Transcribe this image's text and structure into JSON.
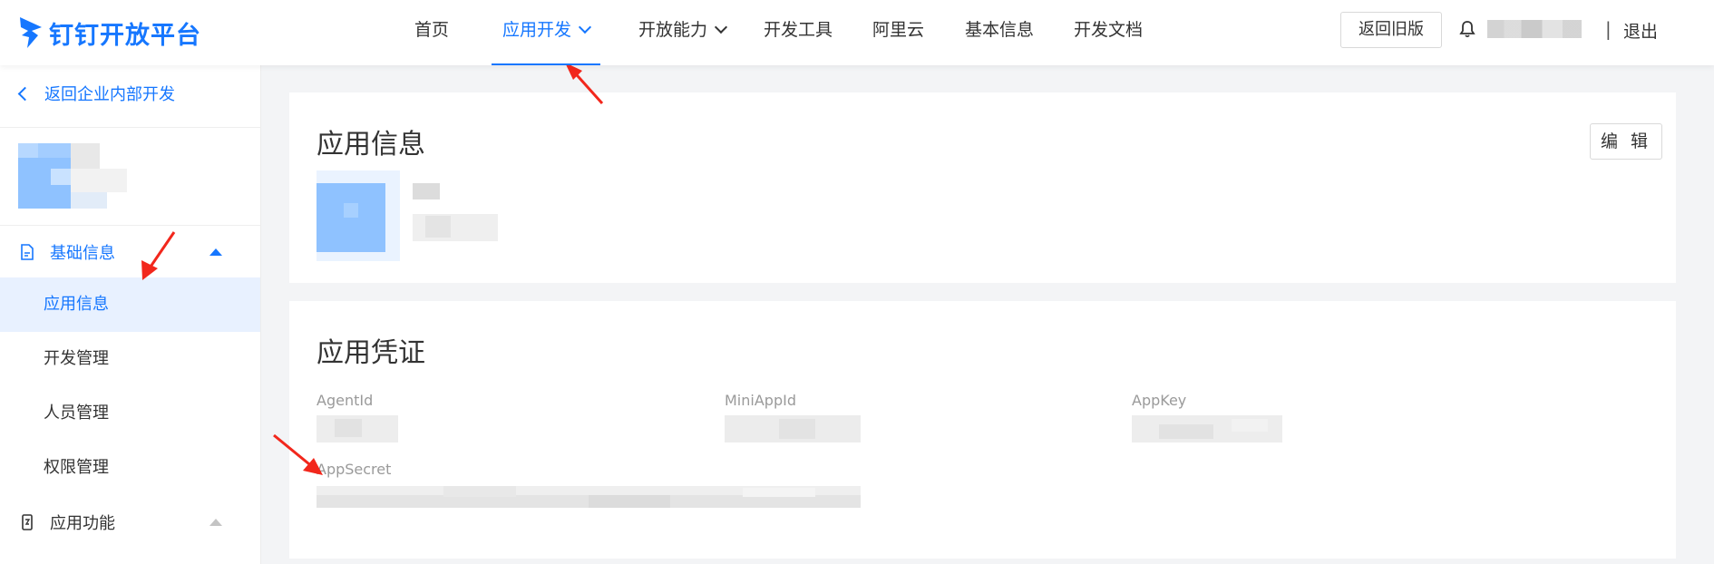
{
  "brand": {
    "name": "钉钉开放平台",
    "color": "#1677ff"
  },
  "nav": {
    "items": [
      {
        "label": "首页"
      },
      {
        "label": "应用开发"
      },
      {
        "label": "开放能力"
      },
      {
        "label": "开发工具"
      },
      {
        "label": "阿里云"
      },
      {
        "label": "基本信息"
      },
      {
        "label": "开发文档"
      }
    ],
    "old_version": "返回旧版",
    "separator": "|",
    "logout": "退出"
  },
  "sidebar": {
    "back": "返回企业内部开发",
    "groups": [
      {
        "label": "基础信息",
        "icon": "document-icon",
        "expanded": true
      },
      {
        "label": "应用功能",
        "icon": "phone-icon",
        "expanded": true
      }
    ],
    "items": [
      {
        "label": "应用信息",
        "selected": true
      },
      {
        "label": "开发管理"
      },
      {
        "label": "人员管理"
      },
      {
        "label": "权限管理"
      }
    ]
  },
  "app_info": {
    "title": "应用信息",
    "edit": "编 辑"
  },
  "credentials": {
    "title": "应用凭证",
    "fields": [
      {
        "label": "AgentId"
      },
      {
        "label": "MiniAppId"
      },
      {
        "label": "AppKey"
      },
      {
        "label": "AppSecret"
      }
    ]
  },
  "colors": {
    "accent": "#1677ff",
    "annotation_arrow": "#f2271c",
    "selected_bg": "#e8f1ff"
  }
}
